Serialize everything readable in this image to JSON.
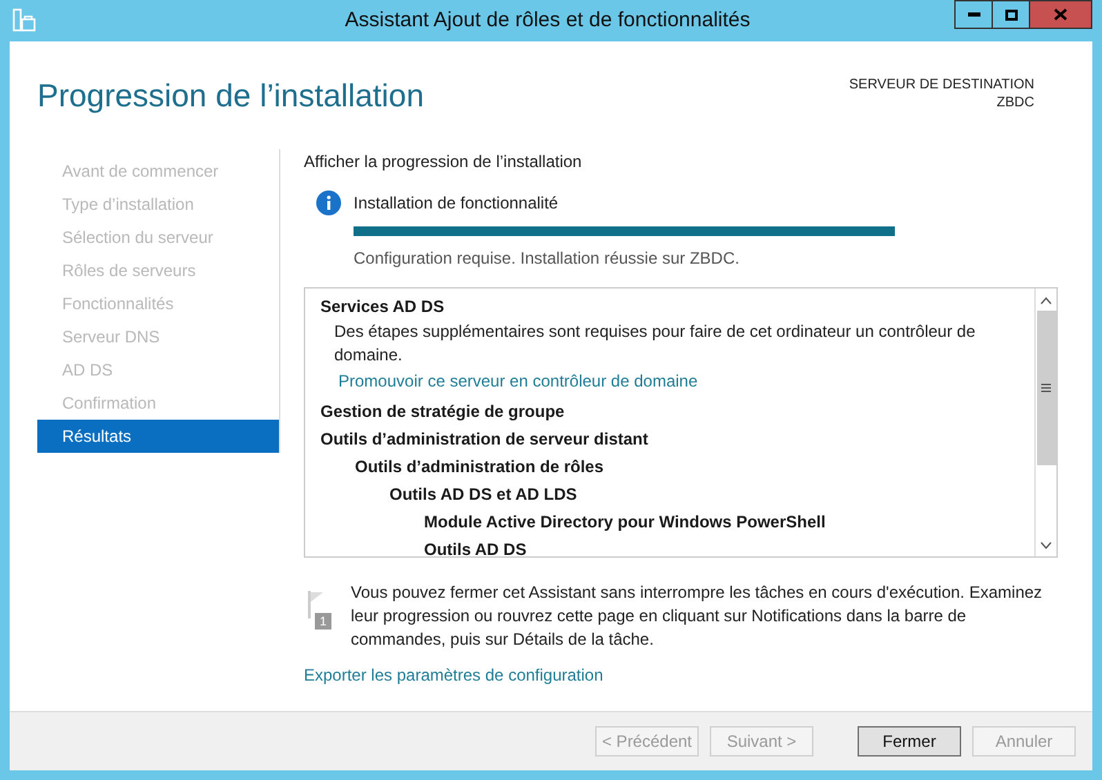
{
  "window": {
    "title": "Assistant Ajout de rôles et de fonctionnalités"
  },
  "page_title": "Progression de l’installation",
  "destination": {
    "label": "SERVEUR DE DESTINATION",
    "server": "ZBDC"
  },
  "sidebar": {
    "items": [
      {
        "label": "Avant de commencer",
        "selected": false
      },
      {
        "label": "Type d’installation",
        "selected": false
      },
      {
        "label": "Sélection du serveur",
        "selected": false
      },
      {
        "label": "Rôles de serveurs",
        "selected": false
      },
      {
        "label": "Fonctionnalités",
        "selected": false
      },
      {
        "label": "Serveur DNS",
        "selected": false
      },
      {
        "label": "AD DS",
        "selected": false
      },
      {
        "label": "Confirmation",
        "selected": false
      },
      {
        "label": "Résultats",
        "selected": true
      }
    ]
  },
  "section_label": "Afficher la progression de l’installation",
  "status": {
    "title": "Installation de fonctionnalité",
    "level": 1,
    "message": "Configuration requise. Installation réussie sur ZBDC."
  },
  "results": [
    {
      "title": "Services AD DS",
      "description": "Des étapes supplémentaires sont requises pour faire de cet ordinateur un contrôleur de domaine.",
      "link": "Promouvoir ce serveur en contrôleur de domaine"
    },
    {
      "title": "Gestion de stratégie de groupe"
    },
    {
      "title": "Outils d’administration de serveur distant",
      "children": [
        {
          "title": "Outils d’administration de rôles",
          "children": [
            {
              "title": "Outils AD DS et AD LDS",
              "children": [
                {
                  "title": "Module Active Directory pour Windows PowerShell"
                },
                {
                  "title": "Outils AD DS"
                }
              ]
            }
          ]
        }
      ]
    }
  ],
  "notice": {
    "badge": "1",
    "text": "Vous pouvez fermer cet Assistant sans interrompre les tâches en cours d'exécution. Examinez leur progression ou rouvrez cette page en cliquant sur Notifications dans la barre de commandes, puis sur Détails de la tâche."
  },
  "export_link": "Exporter les paramètres de configuration",
  "buttons": [
    {
      "label": "< Précédent",
      "disabled": true
    },
    {
      "label": "Suivant >",
      "disabled": true
    },
    {
      "label": "Fermer",
      "disabled": false
    },
    {
      "label": "Annuler",
      "disabled": true
    }
  ]
}
